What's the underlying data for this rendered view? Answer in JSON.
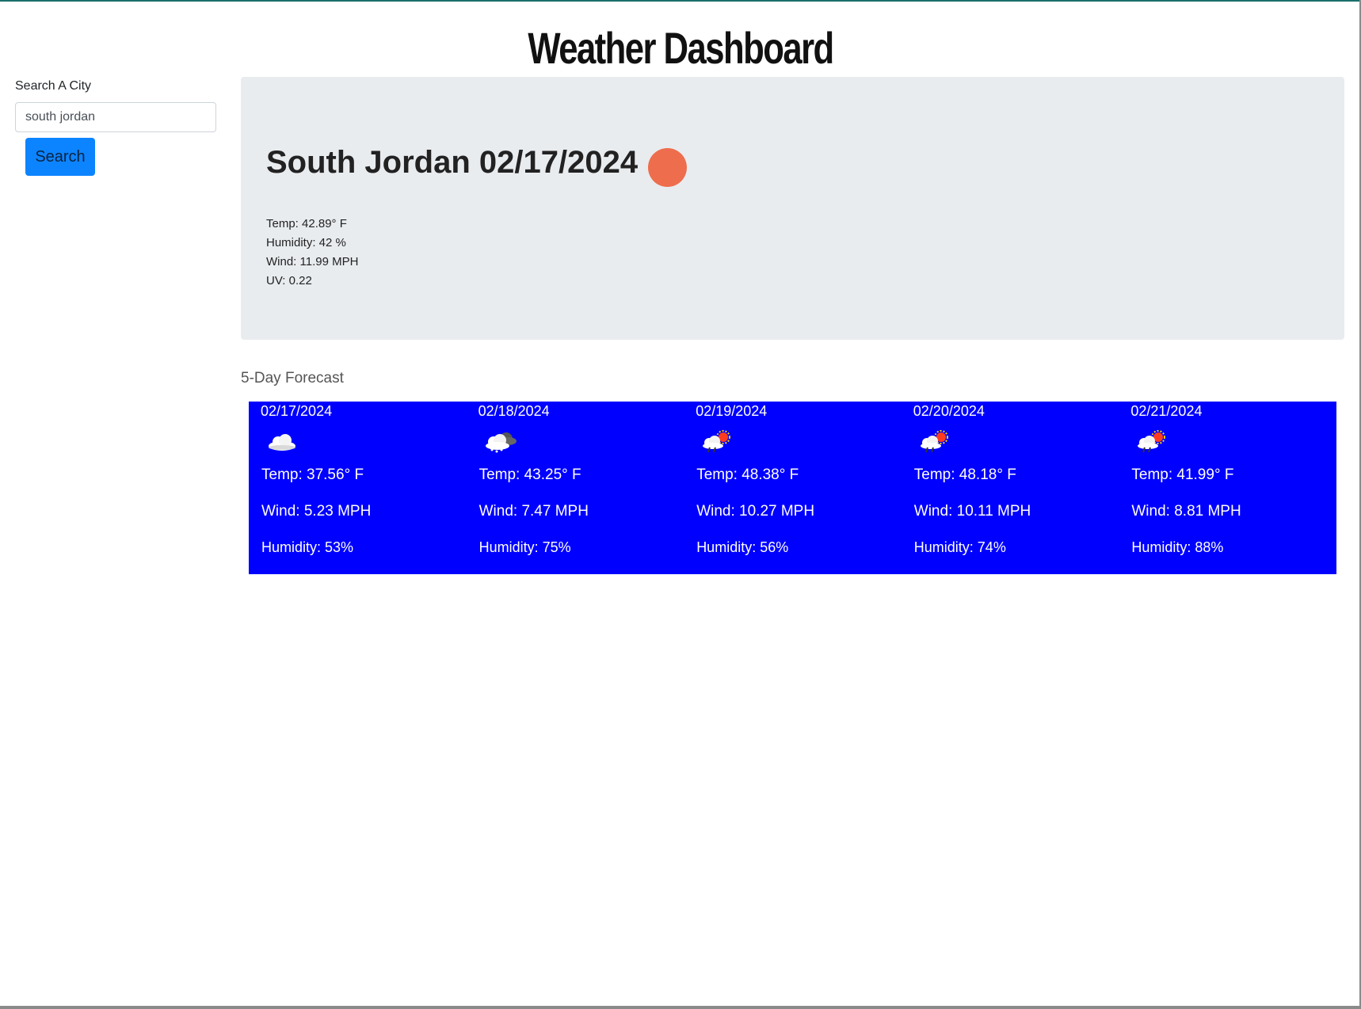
{
  "header": {
    "title": "Weather Dashboard"
  },
  "search": {
    "label": "Search A City",
    "value": "south jordan",
    "button_label": "Search"
  },
  "current": {
    "heading": "South Jordan 02/17/2024",
    "icon": "weather-dot-icon",
    "icon_color": "#ee6d4d",
    "temp": "Temp: 42.89° F",
    "humidity": "Humidity: 42 %",
    "wind": "Wind: 11.99 MPH",
    "uv": "UV: 0.22"
  },
  "forecast": {
    "label": "5-Day Forecast",
    "background": "#0000ff",
    "days": [
      {
        "date": "02/17/2024",
        "icon": "cloud-icon",
        "temp": "Temp: 37.56° F",
        "wind": "Wind: 5.23 MPH",
        "humidity": "Humidity: 53%"
      },
      {
        "date": "02/18/2024",
        "icon": "snow-cloud-icon",
        "temp": "Temp: 43.25° F",
        "wind": "Wind: 7.47 MPH",
        "humidity": "Humidity: 75%"
      },
      {
        "date": "02/19/2024",
        "icon": "rain-sun-icon",
        "temp": "Temp: 48.38° F",
        "wind": "Wind: 10.27 MPH",
        "humidity": "Humidity: 56%"
      },
      {
        "date": "02/20/2024",
        "icon": "rain-sun-icon",
        "temp": "Temp: 48.18° F",
        "wind": "Wind: 10.11 MPH",
        "humidity": "Humidity: 74%"
      },
      {
        "date": "02/21/2024",
        "icon": "rain-sun-icon",
        "temp": "Temp: 41.99° F",
        "wind": "Wind: 8.81 MPH",
        "humidity": "Humidity: 88%"
      }
    ]
  }
}
